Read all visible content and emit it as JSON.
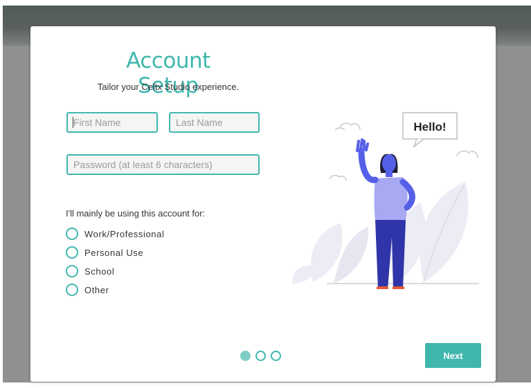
{
  "modal": {
    "title": "Account Setup",
    "subtitle": "Tailor your Celtx Studio experience."
  },
  "form": {
    "first_name_placeholder": "First Name",
    "last_name_placeholder": "Last Name",
    "password_placeholder": "Password (at least 6 characters)",
    "usage_question": "I'll mainly be using this account for:",
    "usage_options": [
      {
        "label": "Work/Professional",
        "selected": false
      },
      {
        "label": "Personal Use",
        "selected": false
      },
      {
        "label": "School",
        "selected": false
      },
      {
        "label": "Other",
        "selected": false
      }
    ]
  },
  "illustration": {
    "speech_bubble": "Hello!"
  },
  "pagination": {
    "current_step": 1,
    "total_steps": 3
  },
  "footer": {
    "next_label": "Next"
  },
  "colors": {
    "accent": "#40b7ad",
    "dot_active": "#7fcec6",
    "figure": "#3f44c8",
    "skin": "#5560e8"
  }
}
